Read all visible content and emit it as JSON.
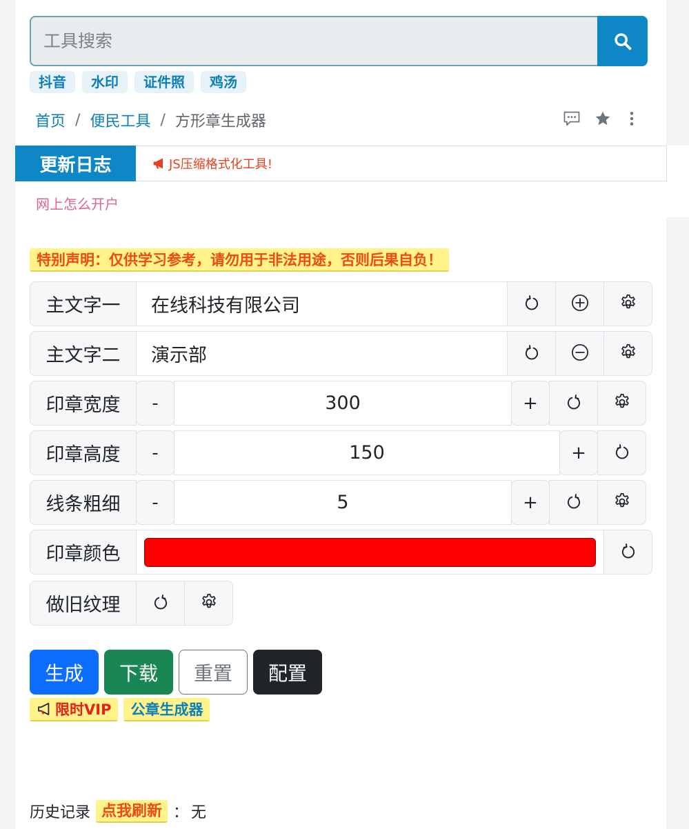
{
  "search": {
    "placeholder": "工具搜索"
  },
  "tags": [
    "抖音",
    "水印",
    "证件照",
    "鸡汤"
  ],
  "breadcrumb": {
    "home": "首页",
    "section": "便民工具",
    "current": "方形章生成器"
  },
  "update_log": {
    "title": "更新日志",
    "message": "JS压缩格式化工具!"
  },
  "ad_link": "网上怎么开户",
  "notice": "特别声明：仅供学习参考，请勿用于非法用途，否则后果自负！",
  "form": {
    "main_text_1": {
      "label": "主文字一",
      "value": "在线科技有限公司"
    },
    "main_text_2": {
      "label": "主文字二",
      "value": "演示部"
    },
    "width": {
      "label": "印章宽度",
      "value": "300",
      "minus": "-",
      "plus": "+"
    },
    "height": {
      "label": "印章高度",
      "value": "150",
      "minus": "-",
      "plus": "+"
    },
    "line": {
      "label": "线条粗细",
      "value": "5",
      "minus": "-",
      "plus": "+"
    },
    "color": {
      "label": "印章颜色",
      "value": "#ff0000"
    },
    "texture": {
      "label": "做旧纹理"
    }
  },
  "buttons": {
    "generate": "生成",
    "download": "下载",
    "reset": "重置",
    "config": "配置"
  },
  "promos": {
    "vip": "限时VIP",
    "official": "公章生成器"
  },
  "history": {
    "label": "历史记录",
    "refresh": "点我刷新",
    "colon": "：",
    "value": "无"
  },
  "colors": {
    "accent": "#0d87c5",
    "notice_bg": "#fff38a",
    "notice_text": "#f04a14",
    "stamp_red": "#ff0000"
  }
}
